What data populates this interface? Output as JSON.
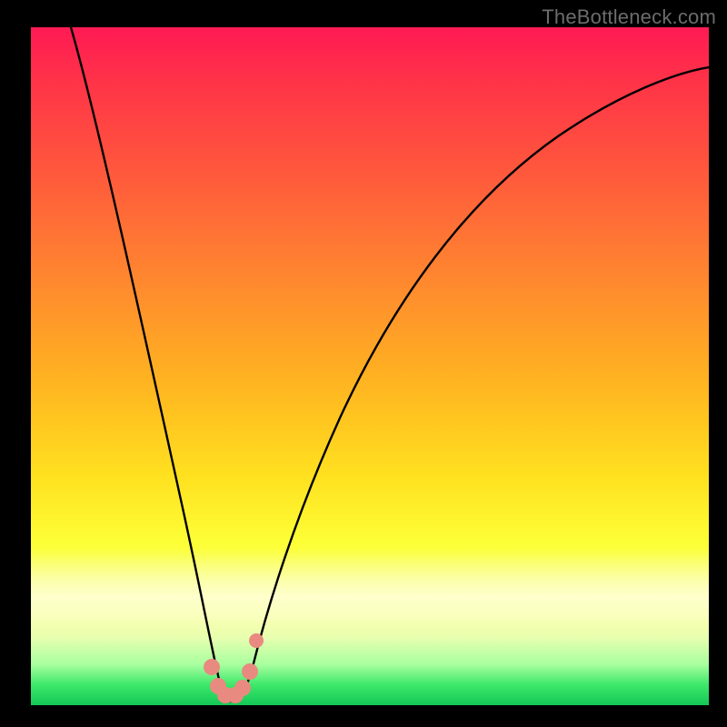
{
  "watermark": "TheBottleneck.com",
  "chart_data": {
    "type": "line",
    "title": "",
    "xlabel": "",
    "ylabel": "",
    "xlim": [
      0,
      100
    ],
    "ylim": [
      0,
      100
    ],
    "grid": false,
    "legend": false,
    "series": [
      {
        "name": "bottleneck-curve",
        "x": [
          6,
          10,
          14,
          18,
          22,
          24,
          26,
          27,
          28,
          29,
          30,
          31,
          32,
          34,
          38,
          44,
          52,
          62,
          74,
          88,
          100
        ],
        "values": [
          100,
          86,
          70,
          52,
          32,
          20,
          10,
          5,
          2,
          1,
          1,
          2,
          5,
          12,
          26,
          42,
          56,
          68,
          78,
          85,
          88
        ]
      }
    ],
    "markers": [
      {
        "name": "marker-a",
        "x": 26.5,
        "value": 5.0
      },
      {
        "name": "marker-b",
        "x": 27.5,
        "value": 2.5
      },
      {
        "name": "marker-c",
        "x": 28.5,
        "value": 1.5
      },
      {
        "name": "marker-d",
        "x": 30.0,
        "value": 1.5
      },
      {
        "name": "marker-e",
        "x": 31.0,
        "value": 2.5
      },
      {
        "name": "marker-f",
        "x": 32.0,
        "value": 5.5
      },
      {
        "name": "marker-g",
        "x": 33.0,
        "value": 10.0
      }
    ],
    "background_gradient": {
      "top": "#ff1a54",
      "mid": "#ffe01f",
      "bottom": "#14c756"
    }
  }
}
